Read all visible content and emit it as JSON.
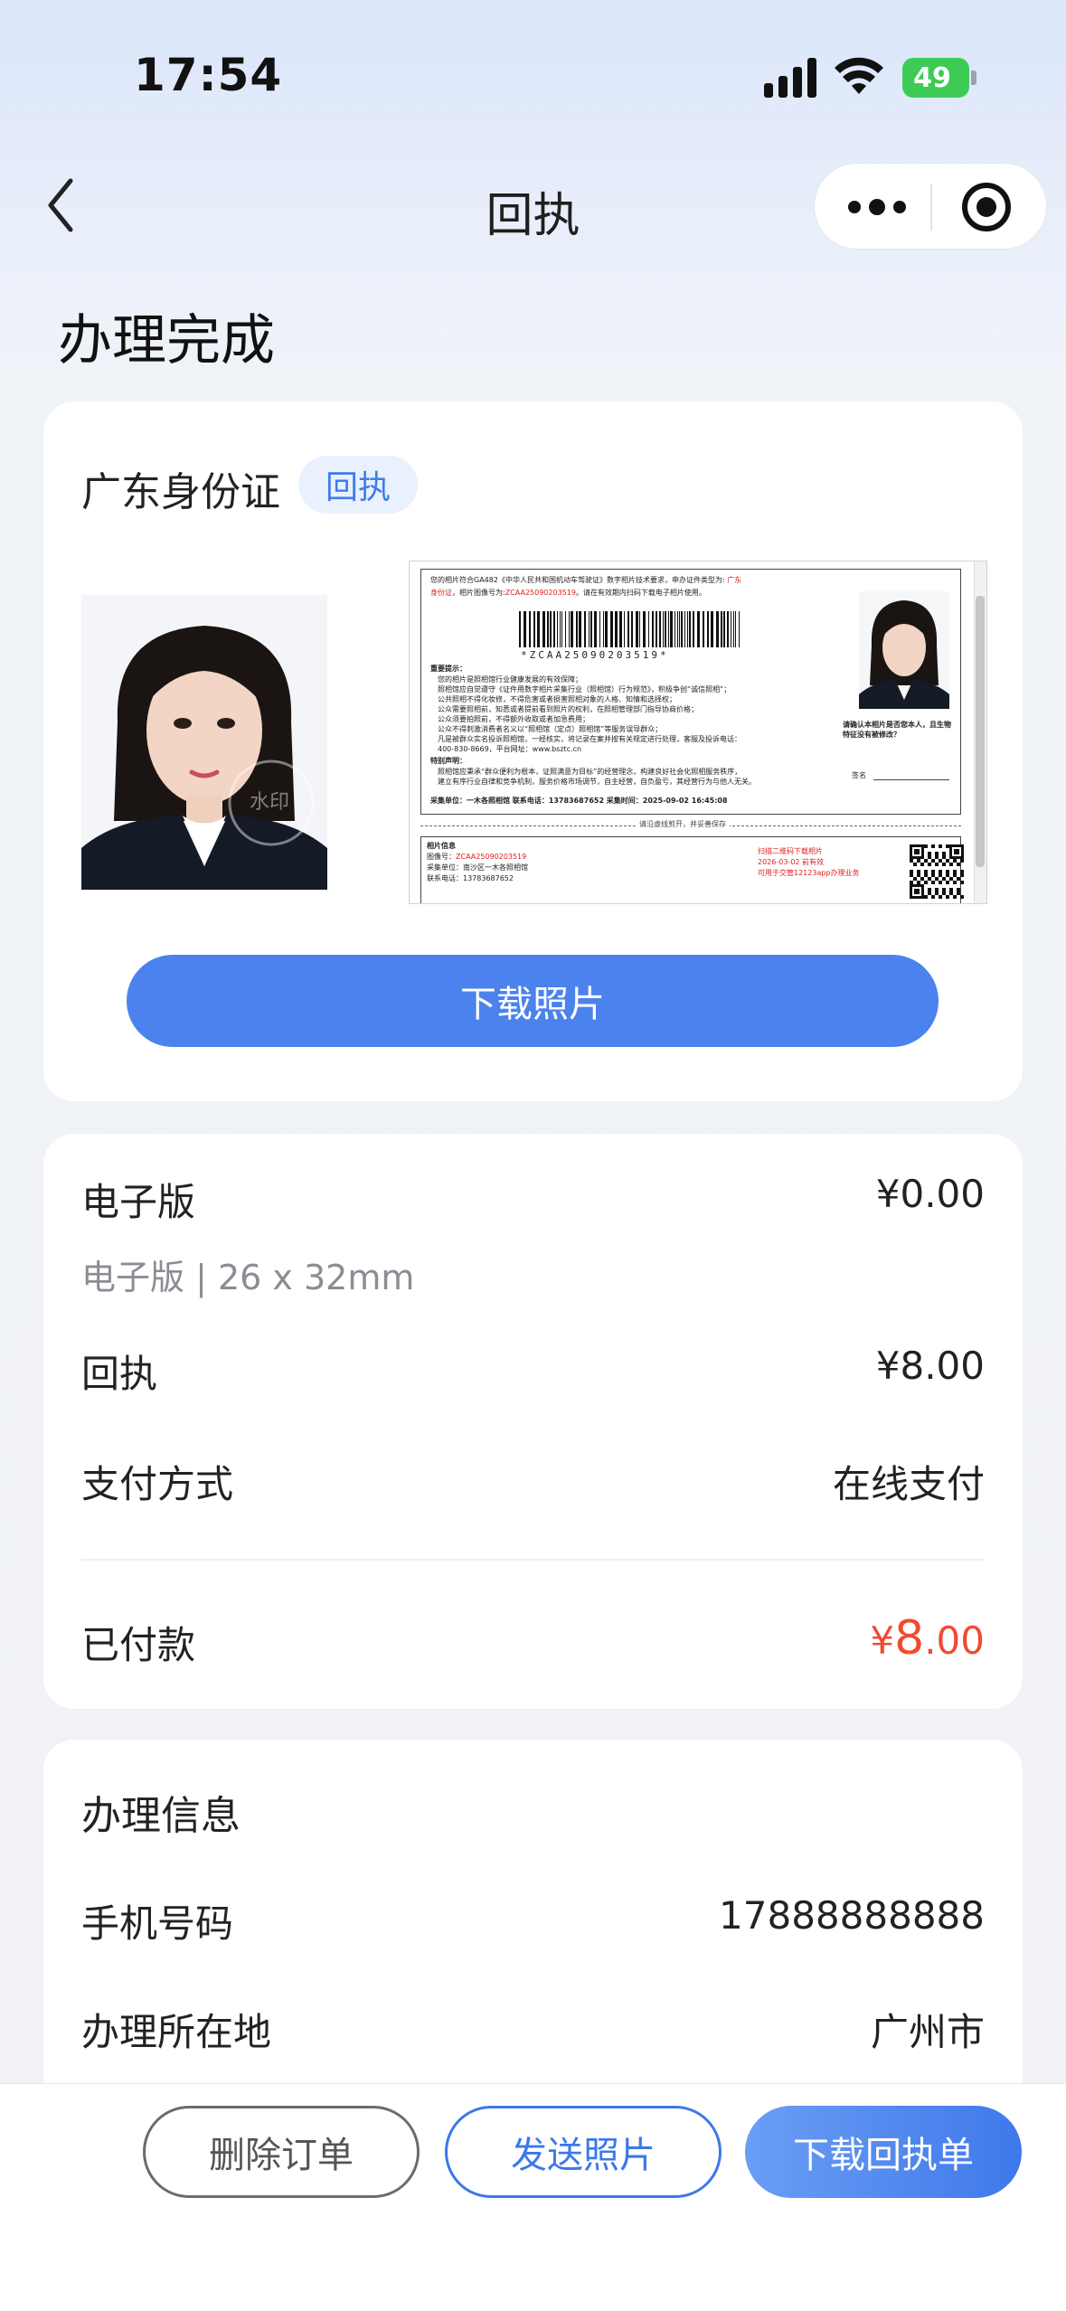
{
  "status_bar": {
    "time": "17:54",
    "battery": "49"
  },
  "nav": {
    "title": "回执"
  },
  "page": {
    "heading": "办理完成"
  },
  "document": {
    "title": "广东身份证",
    "badge": "回执",
    "download_photo_label": "下载照片",
    "receipt": {
      "intro_line1": "您的相片符合GA482《中华人民共和国机动车驾驶证》数字相片技术要求，申办证件类型为:",
      "intro_type": "广东",
      "intro_type2": "身份证",
      "intro_line2": "，相片图像号为:",
      "image_no": "ZCAA25090203519",
      "intro_line2b": "。请在有效期内扫码下载电子相片使用。",
      "barcode_text": "*ZCAA25090203519*",
      "notice_title": "重要提示：",
      "notice_lines": [
        "您的相片是照相馆行业健康发展的有效保障；",
        "照相馆应自觉遵守《证件用数字相片采集行业（照相馆）行为规范》，积极争创“诚信照相”；",
        "公共照相不得化妆修，不得危害或者损害照相对象的人格、知情和选择权；",
        "公众需要照相前，知悉或者提前看到照片的权利，在照相管理部门指导协商价格；",
        "公众须要拍照前，不得额外收取或者加急费用；",
        "公众不得刺激消费者名义以“照相馆（定点）照相馆”等服务误导群众；",
        "凡是被群众实名投诉照相馆，一经核实，将记录在案并按有关规定进行处理，客服及投诉电话：",
        "400-830-8669，平台网址：www.bsztc.cn"
      ],
      "special_title": "特别声明：",
      "special_lines": [
        "照相馆应秉承“群众便利为根本，证照满意为目标”的经营理念，构建良好社会化照相服务秩序，",
        "建立有序行业自律和竞争机制，服务价格市场调节，自主经营，自负盈亏，其经营行为与他人无关。"
      ],
      "footer_line": "采集单位：一木各照相馆     联系电话：13783687652     采集时间：2025-09-02 16:45:08",
      "confirm_text": "请确认本相片是否您本人，且生物特征没有被修改？",
      "sign_label": "签名",
      "cut_text": "请沿虚线剪开，并妥善保存",
      "stub_title": "相片信息",
      "stub_image_no_label": "图像号：",
      "stub_image_no": "ZCAA25090203519",
      "stub_unit": "采集单位：南沙区一木各照相馆",
      "stub_phone": "联系电话：13783687652",
      "stub_scan": "扫描二维码下载相片",
      "stub_validity": "2026-03-02 前有效",
      "stub_reuse": "可用于交管12123app办理业务"
    }
  },
  "order": {
    "electronic_label": "电子版",
    "electronic_price": "¥0.00",
    "electronic_spec": "电子版 | 26 x 32mm",
    "receipt_label": "回执",
    "receipt_price": "¥8.00",
    "payment_method_label": "支付方式",
    "payment_method_value": "在线支付",
    "paid_label": "已付款",
    "paid_currency": "¥",
    "paid_integer": "8",
    "paid_decimal": ".00"
  },
  "info": {
    "title": "办理信息",
    "phone_label": "手机号码",
    "phone_value": "17888888888",
    "location_label": "办理所在地",
    "location_value": "广州市"
  },
  "bottom_bar": {
    "delete_label": "删除订单",
    "send_label": "发送照片",
    "download_receipt_label": "下载回执单"
  },
  "colors": {
    "primary": "#4b82ee",
    "accent_red": "#f04b32",
    "badge_bg": "#e9f1fe"
  },
  "icons": [
    "back-chevron-icon",
    "more-dots-icon",
    "target-circle-icon",
    "signal-icon",
    "wifi-icon",
    "battery-icon"
  ]
}
